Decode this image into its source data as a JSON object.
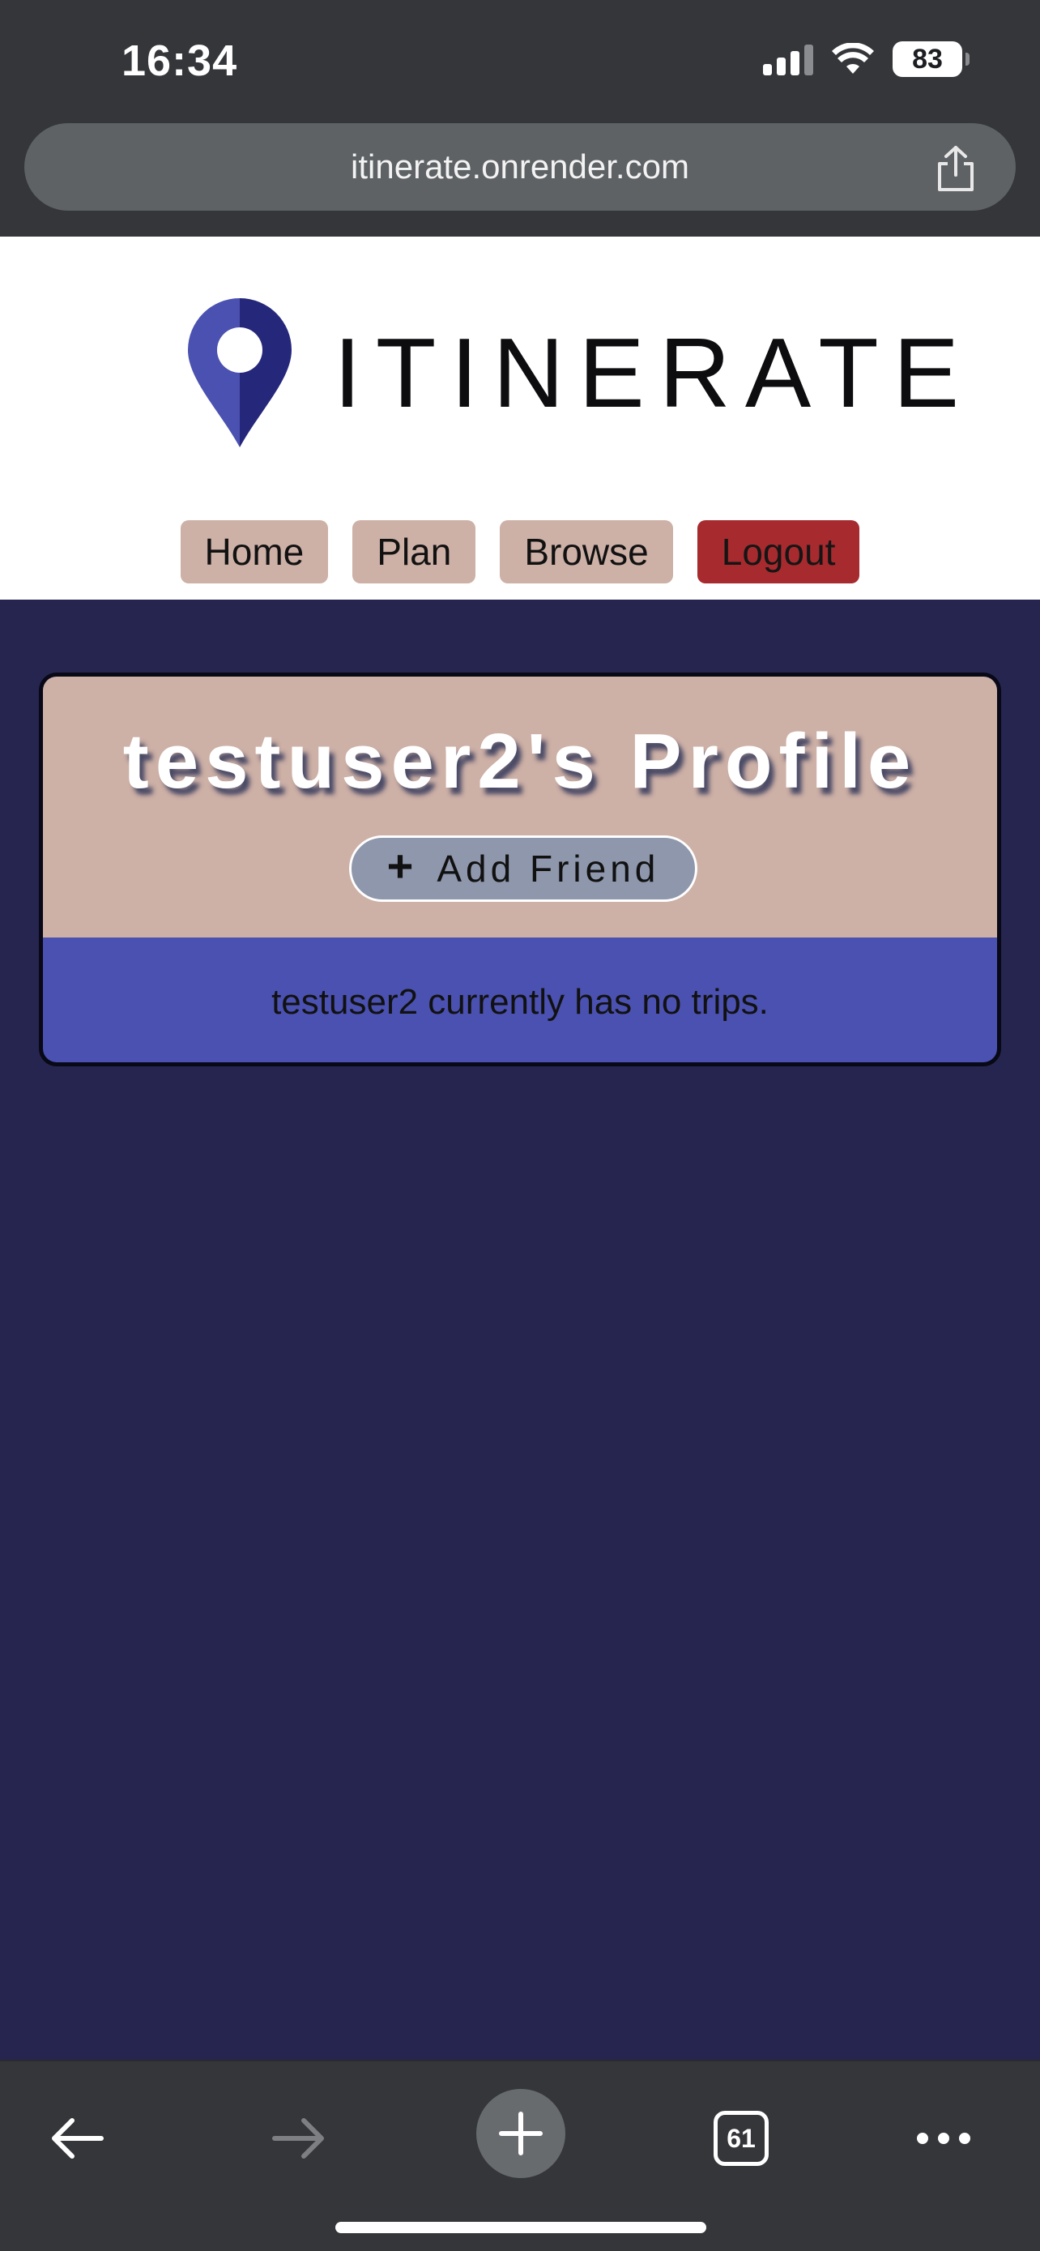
{
  "status_bar": {
    "time": "16:34",
    "battery": "83"
  },
  "browser": {
    "url": "itinerate.onrender.com",
    "tabs_count": "61"
  },
  "site": {
    "logo_text": "ITINERATE",
    "colors": {
      "nav_button": "#cdb0a6",
      "logout_button": "#a62a2e",
      "background": "#25254f",
      "card_body": "#4a51b0"
    },
    "nav": [
      {
        "label": "Home"
      },
      {
        "label": "Plan"
      },
      {
        "label": "Browse"
      },
      {
        "label": "Logout"
      }
    ]
  },
  "profile": {
    "title": "testuser2's Profile",
    "add_friend_label": "Add Friend",
    "empty_message": "testuser2 currently has no trips."
  },
  "icons": {
    "back": "back-arrow-icon",
    "forward": "forward-arrow-icon",
    "new_tab": "plus-icon",
    "tabs": "tabs-icon",
    "more": "more-icon",
    "share": "share-icon",
    "logo": "map-pin-icon"
  }
}
